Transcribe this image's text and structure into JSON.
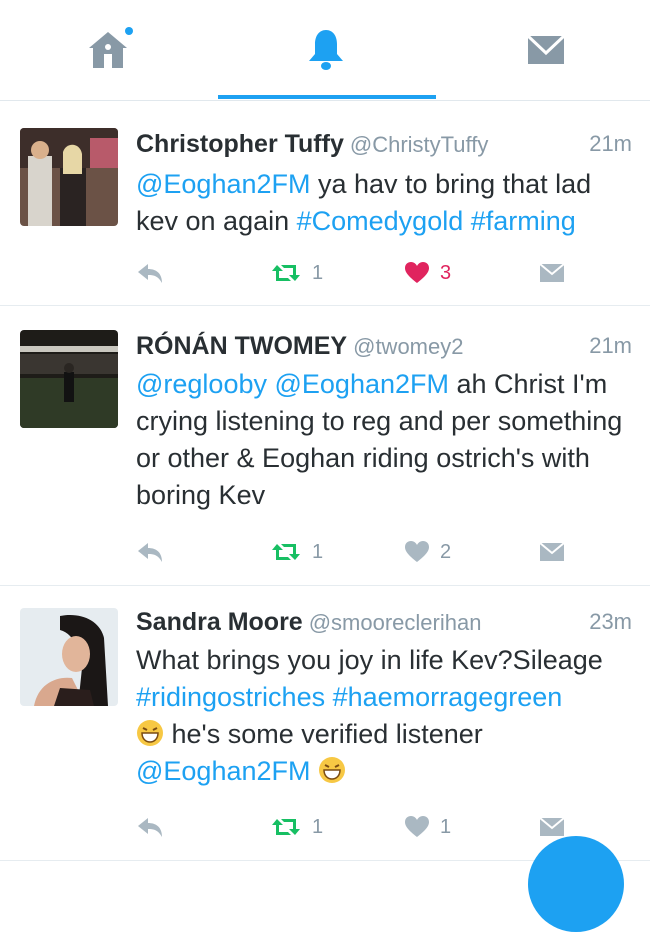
{
  "nav": {
    "tabs": [
      {
        "name": "home",
        "icon": "home-icon"
      },
      {
        "name": "notifications",
        "icon": "bell-icon",
        "active": true
      },
      {
        "name": "messages",
        "icon": "envelope-icon"
      }
    ],
    "accent": "#1da1f2",
    "icon_color": "#8899a6"
  },
  "tweets": [
    {
      "name": "Christopher Tuffy",
      "handle": "@ChristyTuffy",
      "time": "21m",
      "text_parts": [
        {
          "t": "@Eoghan2FM",
          "link": true
        },
        {
          "t": " ya hav to bring that lad kev on again ",
          "link": false
        },
        {
          "t": "#Comedygold",
          "link": true
        },
        {
          "t": " ",
          "link": false
        },
        {
          "t": "#farming",
          "link": true
        }
      ],
      "retweets": "1",
      "likes": "3",
      "liked": true
    },
    {
      "name": "RÓNÁN TWOMEY",
      "handle": "@twomey2",
      "time": "21m",
      "text_parts": [
        {
          "t": "@reglooby",
          "link": true
        },
        {
          "t": " ",
          "link": false
        },
        {
          "t": "@Eoghan2FM",
          "link": true
        },
        {
          "t": " ah Christ I'm crying listening to reg and per something or other & Eoghan riding ostrich's with boring Kev",
          "link": false
        }
      ],
      "retweets": "1",
      "likes": "2",
      "liked": false
    },
    {
      "name": "Sandra Moore",
      "handle": "@smooreclerihan",
      "time": "23m",
      "line1": "What brings you joy in life Kev?Sileage",
      "line2_tags": [
        "#ridingostriches",
        "#haemorragegreen"
      ],
      "line3": " he's some verified listener",
      "line4_mention": "@Eoghan2FM",
      "retweets": "1",
      "likes": "1",
      "liked": false
    }
  ],
  "colors": {
    "like_active": "#e0245e",
    "retweet": "#17bf63",
    "text": "#292f33",
    "muted": "#8899a6"
  }
}
